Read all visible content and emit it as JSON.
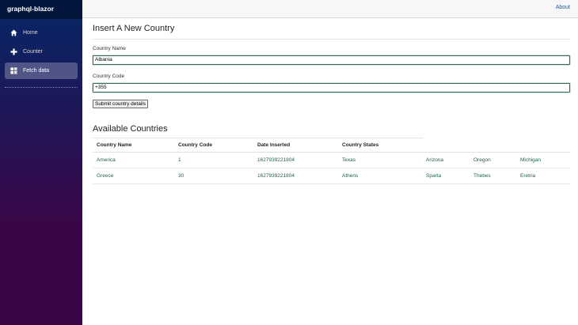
{
  "sidebar": {
    "brand": "graphql-blazor",
    "items": [
      {
        "label": "Home",
        "icon": "home-icon"
      },
      {
        "label": "Counter",
        "icon": "plus-icon"
      },
      {
        "label": "Fetch data",
        "icon": "list-icon"
      }
    ]
  },
  "topbar": {
    "about_label": "About"
  },
  "form": {
    "title": "Insert A New Country",
    "country_name_label": "Country Name",
    "country_name_value": "Albania",
    "country_code_label": "Country Code",
    "country_code_value": "+355",
    "submit_label": "Submit country details"
  },
  "countries": {
    "title": "Available Countries",
    "headers": [
      "Country Name",
      "Country Code",
      "Date Inserted",
      "Country States"
    ],
    "rows": [
      {
        "name": "America",
        "code": "1",
        "date": "1627939221804",
        "states": [
          "Texas",
          "Arizona",
          "Oregon",
          "Michigan"
        ]
      },
      {
        "name": "Greece",
        "code": "30",
        "date": "1627939221804",
        "states": [
          "Athens",
          "Sparta",
          "Thebes",
          "Eretria"
        ]
      }
    ]
  },
  "colors": {
    "sidebar_top": "#052767",
    "sidebar_bottom": "#3a0647",
    "link": "#1861ac",
    "table_text": "#1f5f4f"
  }
}
